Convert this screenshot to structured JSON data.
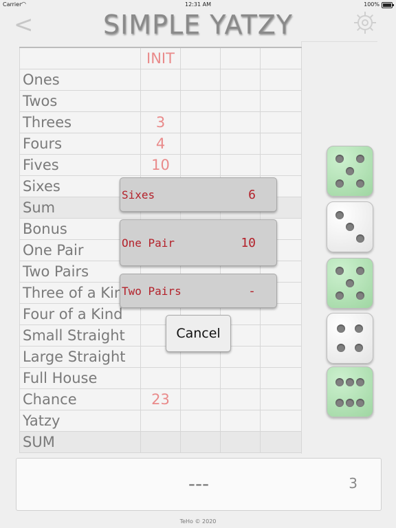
{
  "status_bar": {
    "carrier": "Carrier",
    "time": "12:31 AM",
    "battery": "100%"
  },
  "header": {
    "back_label": "<",
    "title": "SIMPLE YATZY"
  },
  "scoreboard": {
    "player_header": "INIT",
    "rows": [
      {
        "label": "Ones",
        "value": ""
      },
      {
        "label": "Twos",
        "value": ""
      },
      {
        "label": "Threes",
        "value": "3"
      },
      {
        "label": "Fours",
        "value": "4"
      },
      {
        "label": "Fives",
        "value": "10"
      },
      {
        "label": "Sixes",
        "value": ""
      },
      {
        "label": "Sum",
        "value": ""
      },
      {
        "label": "Bonus",
        "value": ""
      },
      {
        "label": "One Pair",
        "value": ""
      },
      {
        "label": "Two Pairs",
        "value": ""
      },
      {
        "label": "Three of a Kind",
        "value": ""
      },
      {
        "label": "Four of a Kind",
        "value": ""
      },
      {
        "label": "Small Straight",
        "value": ""
      },
      {
        "label": "Large Straight",
        "value": ""
      },
      {
        "label": "Full House",
        "value": ""
      },
      {
        "label": "Chance",
        "value": "23"
      },
      {
        "label": "Yatzy",
        "value": ""
      },
      {
        "label": "SUM",
        "value": ""
      }
    ]
  },
  "dice": [
    {
      "face": 5,
      "held": true
    },
    {
      "face": 3,
      "held": false
    },
    {
      "face": 5,
      "held": true
    },
    {
      "face": 4,
      "held": false
    },
    {
      "face": 6,
      "held": true
    }
  ],
  "options": [
    {
      "name": "Sixes",
      "score": "6"
    },
    {
      "name": "One Pair",
      "score": "10"
    },
    {
      "name": "Two Pairs",
      "score": "-"
    }
  ],
  "cancel_label": "Cancel",
  "result_panel": {
    "message": "---",
    "rolls_left": "3"
  },
  "footer": "TeHo © 2020",
  "colors": {
    "score_text": "#e98a8a",
    "option_text": "#b3212a",
    "held_die": "#b4e3b6"
  }
}
